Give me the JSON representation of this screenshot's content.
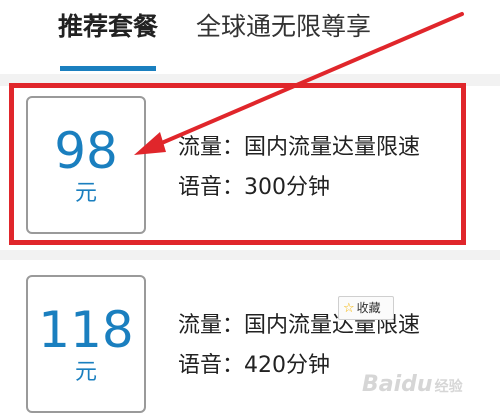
{
  "tabs": [
    {
      "label": "推荐套餐",
      "active": true
    },
    {
      "label": "全球通无限尊享",
      "active": false
    }
  ],
  "plans": [
    {
      "price": "98",
      "unit": "元",
      "data_line": "流量：国内流量达量限速",
      "voice_line": "语音：300分钟"
    },
    {
      "price": "118",
      "unit": "元",
      "data_line": "流量：国内流量达量限速",
      "voice_line": "语音：420分钟"
    }
  ],
  "favorite": {
    "label": "收藏",
    "icon": "star-icon"
  },
  "watermark": {
    "brand": "Baidu",
    "sub": "经验"
  },
  "colors": {
    "accent": "#1a7fbf",
    "annotation": "#e0262b"
  }
}
